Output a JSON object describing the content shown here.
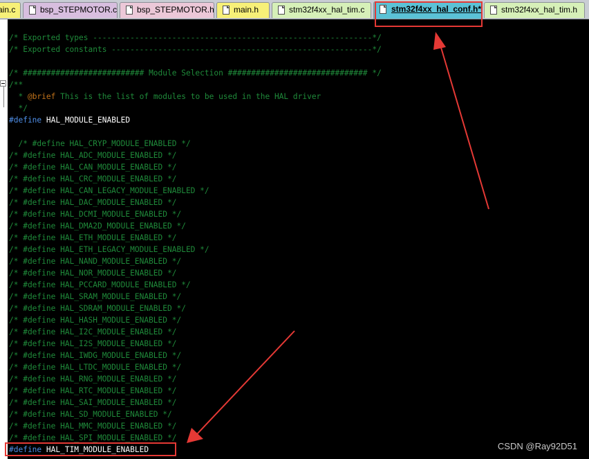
{
  "tabs": [
    {
      "label": "ain.c",
      "color": "#f7f078",
      "edge": true
    },
    {
      "label": "bsp_STEPMOTOR.c",
      "color": "#d8bedf"
    },
    {
      "label": "bsp_STEPMOTOR.h",
      "color": "#ecc8d8"
    },
    {
      "label": "main.h",
      "color": "#f7f078"
    },
    {
      "label": "stm32f4xx_hal_tim.c",
      "color": "#d6f0b8"
    },
    {
      "label": "stm32f4xx_hal_conf.h*",
      "color": "#5bc2d6",
      "active": true
    },
    {
      "label": "stm32f4xx_hal_tim.h",
      "color": "#d6f0b8"
    }
  ],
  "code": {
    "lines": [
      [
        [
          "/* Exported types ------------------------------------------------------------*/",
          "comment"
        ]
      ],
      [
        [
          "/* Exported constants --------------------------------------------------------*/",
          "comment"
        ]
      ],
      [
        [
          "",
          "text"
        ]
      ],
      [
        [
          "/* ########################## Module Selection ############################## */",
          "comment"
        ]
      ],
      [
        [
          "/**",
          "comment"
        ]
      ],
      [
        [
          "  * ",
          "comment"
        ],
        [
          "@brief",
          "tag"
        ],
        [
          " This is the list of modules to be used in the HAL driver",
          "comment"
        ]
      ],
      [
        [
          "  */",
          "comment"
        ]
      ],
      [
        [
          "#define",
          "kw"
        ],
        [
          " HAL_MODULE_ENABLED",
          "text"
        ]
      ],
      [
        [
          "",
          "text"
        ]
      ],
      [
        [
          "  /* #define HAL_CRYP_MODULE_ENABLED */",
          "comment"
        ]
      ],
      [
        [
          "/* #define HAL_ADC_MODULE_ENABLED */",
          "comment"
        ]
      ],
      [
        [
          "/* #define HAL_CAN_MODULE_ENABLED */",
          "comment"
        ]
      ],
      [
        [
          "/* #define HAL_CRC_MODULE_ENABLED */",
          "comment"
        ]
      ],
      [
        [
          "/* #define HAL_CAN_LEGACY_MODULE_ENABLED */",
          "comment"
        ]
      ],
      [
        [
          "/* #define HAL_DAC_MODULE_ENABLED */",
          "comment"
        ]
      ],
      [
        [
          "/* #define HAL_DCMI_MODULE_ENABLED */",
          "comment"
        ]
      ],
      [
        [
          "/* #define HAL_DMA2D_MODULE_ENABLED */",
          "comment"
        ]
      ],
      [
        [
          "/* #define HAL_ETH_MODULE_ENABLED */",
          "comment"
        ]
      ],
      [
        [
          "/* #define HAL_ETH_LEGACY_MODULE_ENABLED */",
          "comment"
        ]
      ],
      [
        [
          "/* #define HAL_NAND_MODULE_ENABLED */",
          "comment"
        ]
      ],
      [
        [
          "/* #define HAL_NOR_MODULE_ENABLED */",
          "comment"
        ]
      ],
      [
        [
          "/* #define HAL_PCCARD_MODULE_ENABLED */",
          "comment"
        ]
      ],
      [
        [
          "/* #define HAL_SRAM_MODULE_ENABLED */",
          "comment"
        ]
      ],
      [
        [
          "/* #define HAL_SDRAM_MODULE_ENABLED */",
          "comment"
        ]
      ],
      [
        [
          "/* #define HAL_HASH_MODULE_ENABLED */",
          "comment"
        ]
      ],
      [
        [
          "/* #define HAL_I2C_MODULE_ENABLED */",
          "comment"
        ]
      ],
      [
        [
          "/* #define HAL_I2S_MODULE_ENABLED */",
          "comment"
        ]
      ],
      [
        [
          "/* #define HAL_IWDG_MODULE_ENABLED */",
          "comment"
        ]
      ],
      [
        [
          "/* #define HAL_LTDC_MODULE_ENABLED */",
          "comment"
        ]
      ],
      [
        [
          "/* #define HAL_RNG_MODULE_ENABLED */",
          "comment"
        ]
      ],
      [
        [
          "/* #define HAL_RTC_MODULE_ENABLED */",
          "comment"
        ]
      ],
      [
        [
          "/* #define HAL_SAI_MODULE_ENABLED */",
          "comment"
        ]
      ],
      [
        [
          "/* #define HAL_SD_MODULE_ENABLED */",
          "comment"
        ]
      ],
      [
        [
          "/* #define HAL_MMC_MODULE_ENABLED */",
          "comment"
        ]
      ],
      [
        [
          "/* #define HAL_SPI_MODULE_ENABLED */",
          "comment"
        ]
      ],
      [
        [
          "#define",
          "kw"
        ],
        [
          " HAL_TIM_MODULE_ENABLED",
          "text"
        ]
      ]
    ]
  },
  "colors": {
    "comment": "#1f8a3a",
    "keyword": "#4f8fe8",
    "doc_tag": "#c0721a",
    "annotation": "#e53935",
    "editor_bg": "#000000"
  },
  "watermark": "CSDN @Ray92D51"
}
